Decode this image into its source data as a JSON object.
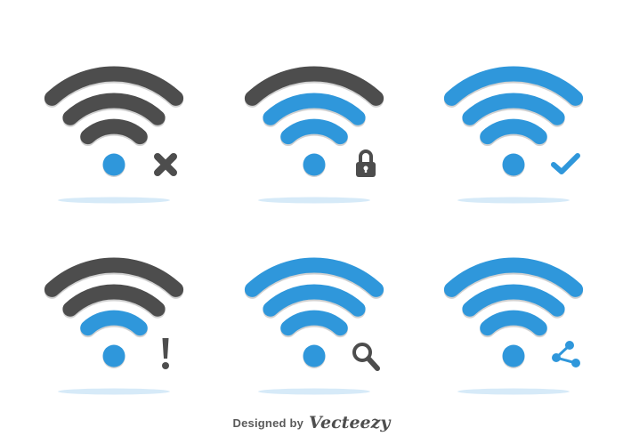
{
  "colors": {
    "active": "#2f97db",
    "inactive": "#4d4d4d",
    "badge": "#4d4d4d",
    "shadow": "#d6eaf8",
    "background": "#ffffff"
  },
  "icons": [
    {
      "name": "wifi-disconnected-icon",
      "badge": "x-mark-icon",
      "bars_active": [
        false,
        false,
        false
      ],
      "dot_active": true
    },
    {
      "name": "wifi-locked-icon",
      "badge": "padlock-icon",
      "bars_active": [
        false,
        true,
        true
      ],
      "dot_active": true
    },
    {
      "name": "wifi-connected-icon",
      "badge": "checkmark-icon",
      "bars_active": [
        true,
        true,
        true
      ],
      "dot_active": true
    },
    {
      "name": "wifi-warning-icon",
      "badge": "exclamation-icon",
      "bars_active": [
        false,
        false,
        true
      ],
      "dot_active": true
    },
    {
      "name": "wifi-search-icon",
      "badge": "magnifier-icon",
      "bars_active": [
        true,
        true,
        true
      ],
      "dot_active": true
    },
    {
      "name": "wifi-share-icon",
      "badge": "share-icon",
      "bars_active": [
        true,
        true,
        true
      ],
      "dot_active": true
    }
  ],
  "credit": {
    "prefix": "Designed by",
    "brand": "Vecteezy"
  }
}
